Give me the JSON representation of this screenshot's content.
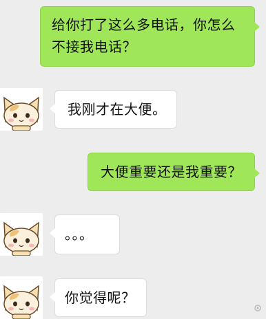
{
  "messages": [
    {
      "side": "sent",
      "text_line1": "给你打了这么多电话，你怎么",
      "text_line2": "不接我电话？"
    },
    {
      "side": "received",
      "avatar_icon": "cat-avatar-icon",
      "text": "我刚才在大便。"
    },
    {
      "side": "sent",
      "text": "大便重要还是我重要？"
    },
    {
      "side": "received",
      "avatar_icon": "cat-avatar-icon",
      "text": "。。。"
    },
    {
      "side": "received",
      "avatar_icon": "cat-avatar-icon",
      "text": "你觉得呢？"
    }
  ],
  "colors": {
    "background": "#ededed",
    "sent_bubble": "#9fe658",
    "received_bubble": "#ffffff",
    "text": "#111111"
  }
}
